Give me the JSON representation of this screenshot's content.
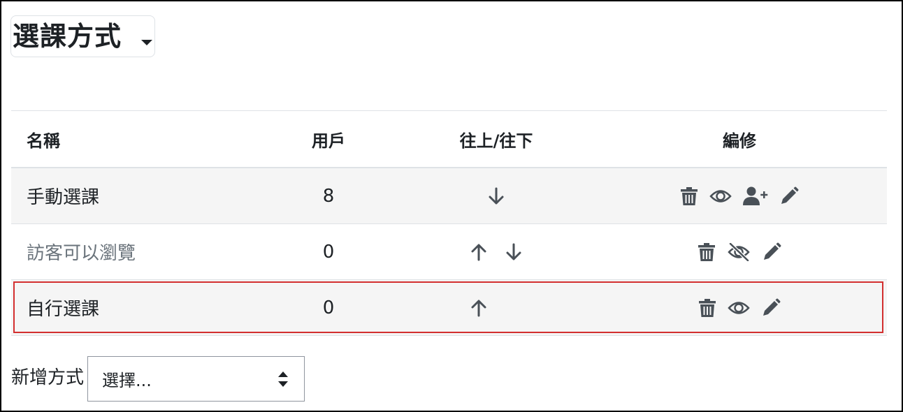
{
  "page": {
    "title": "選課方式",
    "colors": {
      "icon": "#495057",
      "highlight": "#d32f2f",
      "dim_text": "#6a737b"
    }
  },
  "table": {
    "headers": {
      "name": "名稱",
      "users": "用戶",
      "updown": "往上/往下",
      "edit": "編修"
    },
    "rows": [
      {
        "name": "手動選課",
        "users": "8",
        "up": false,
        "down": true,
        "icons": [
          "trash-icon",
          "eye-icon",
          "user-plus-icon",
          "pencil-icon"
        ],
        "dimmed": false
      },
      {
        "name": "訪客可以瀏覽",
        "users": "0",
        "up": true,
        "down": true,
        "icons": [
          "trash-icon",
          "eye-slash-icon",
          "pencil-icon"
        ],
        "dimmed": true
      },
      {
        "name": "自行選課",
        "users": "0",
        "up": true,
        "down": false,
        "icons": [
          "trash-icon",
          "eye-icon",
          "pencil-icon"
        ],
        "dimmed": false
      }
    ]
  },
  "add_method": {
    "label": "新增方式",
    "select_value": "選擇..."
  }
}
